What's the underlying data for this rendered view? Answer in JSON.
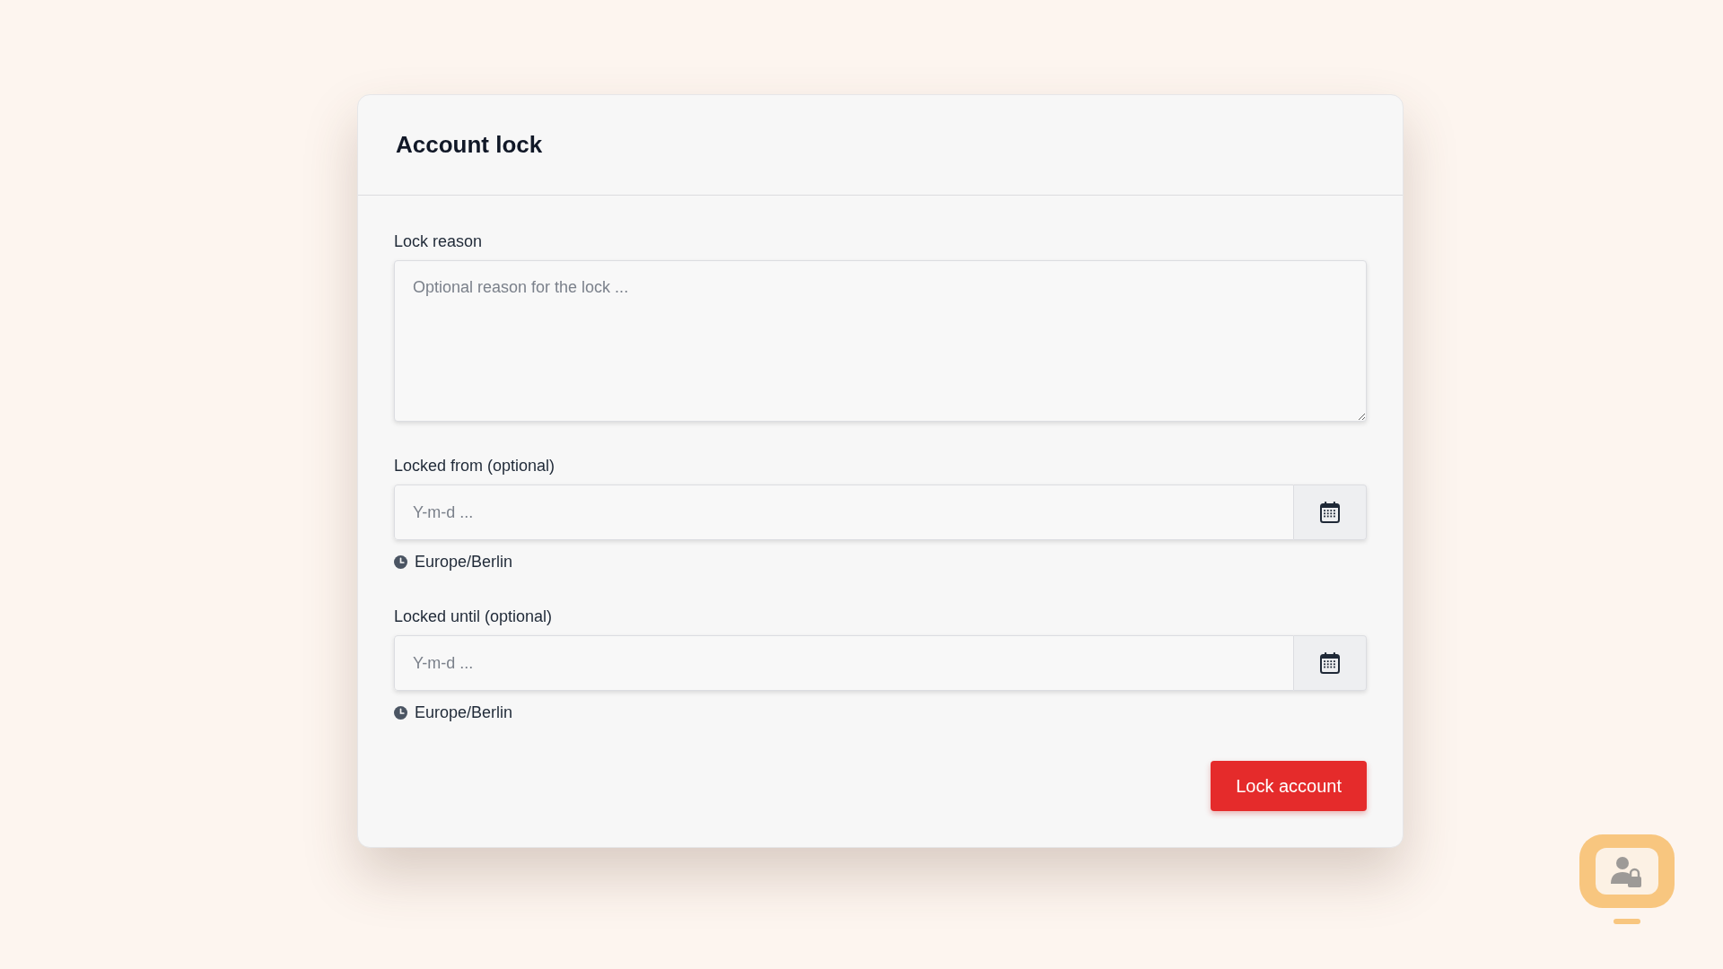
{
  "card": {
    "title": "Account lock"
  },
  "fields": [
    {
      "kind": "textarea",
      "label": "Lock reason",
      "placeholder": "Optional reason for the lock ..."
    },
    {
      "kind": "date",
      "label": "Locked from (optional)",
      "placeholder": "Y-m-d ...",
      "timezone": "Europe/Berlin"
    },
    {
      "kind": "date",
      "label": "Locked until (optional)",
      "placeholder": "Y-m-d ...",
      "timezone": "Europe/Berlin"
    }
  ],
  "submit": {
    "label": "Lock account"
  }
}
